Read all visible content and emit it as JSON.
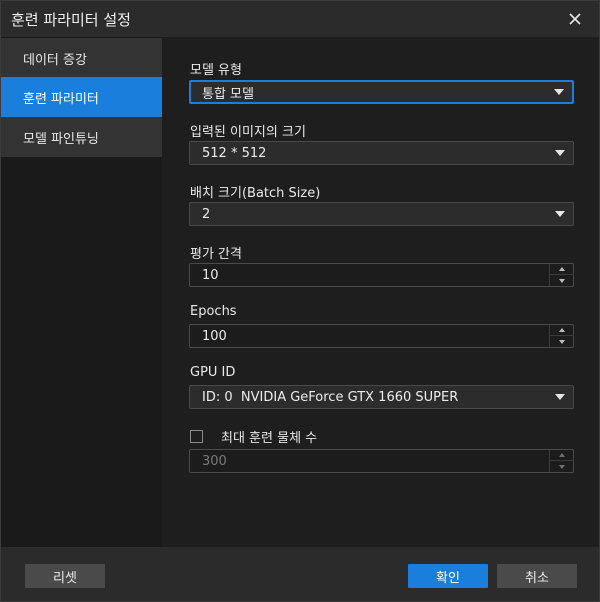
{
  "window": {
    "title": "훈련 파라미터 설정"
  },
  "sidebar": {
    "items": [
      {
        "label": "데이터 증강"
      },
      {
        "label": "훈련 파라미터"
      },
      {
        "label": "모델 파인튜닝"
      }
    ],
    "active_index": 1
  },
  "form": {
    "model_type": {
      "label": "모델 유형",
      "value": "통합 모델"
    },
    "input_size": {
      "label": "입력된 이미지의 크기",
      "value": "512 * 512"
    },
    "batch_size": {
      "label": "배치 크기(Batch Size)",
      "value": "2"
    },
    "eval_interval": {
      "label": "평가 간격",
      "value": "10"
    },
    "epochs": {
      "label": "Epochs",
      "value": "100"
    },
    "gpu_id": {
      "label": "GPU ID",
      "value": "ID: 0  NVIDIA GeForce GTX 1660 SUPER"
    },
    "max_objects": {
      "label": "최대 훈련 물체 수",
      "value": "300",
      "checked": false,
      "disabled": true
    }
  },
  "footer": {
    "reset_label": "리셋",
    "confirm_label": "확인",
    "cancel_label": "취소"
  },
  "colors": {
    "accent": "#1a7fdc",
    "background": "#1e1e1e",
    "panel": "#2b2b2b"
  },
  "icons": {
    "close": "close-icon",
    "dropdown": "chevron-down-icon",
    "spin_up": "arrow-up-icon",
    "spin_down": "arrow-down-icon"
  }
}
